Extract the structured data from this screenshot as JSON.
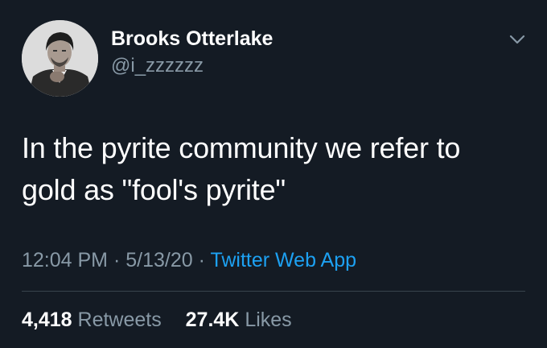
{
  "tweet": {
    "author": {
      "display_name": "Brooks Otterlake",
      "handle": "@i_zzzzzz",
      "avatar_icon": "user-photo-avatar"
    },
    "menu_icon": "chevron-down-icon",
    "text_line1": "In the pyrite community we refer to",
    "text_line2": "gold as \"fool's pyrite\"",
    "time": "12:04 PM",
    "separator": "·",
    "date": "5/13/20",
    "source": "Twitter Web App",
    "retweets_count": "4,418",
    "retweets_label": "Retweets",
    "likes_count": "27.4K",
    "likes_label": "Likes"
  },
  "colors": {
    "background": "#141b24",
    "text": "#ffffff",
    "secondary_text": "#8899a6",
    "accent": "#1da1f2",
    "divider": "#38444d"
  }
}
